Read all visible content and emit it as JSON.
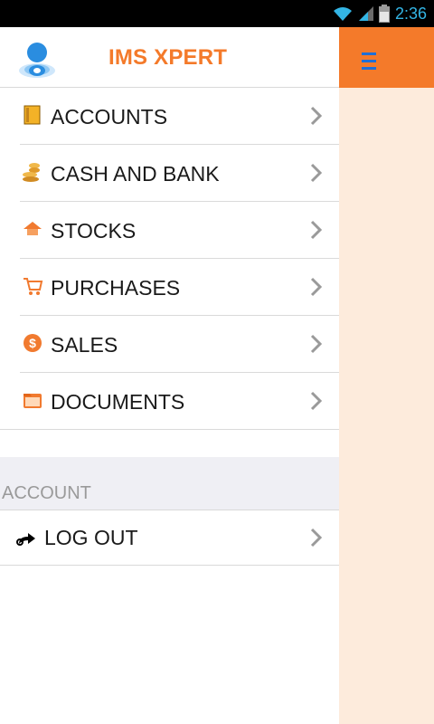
{
  "status": {
    "time": "2:36"
  },
  "app": {
    "title": "IMS XPERT"
  },
  "menu": {
    "items": [
      {
        "label": "ACCOUNTS",
        "icon": "book-icon"
      },
      {
        "label": "CASH AND BANK",
        "icon": "coins-icon"
      },
      {
        "label": "STOCKS",
        "icon": "home-icon"
      },
      {
        "label": "PURCHASES",
        "icon": "cart-icon"
      },
      {
        "label": "SALES",
        "icon": "dollar-icon"
      },
      {
        "label": "DOCUMENTS",
        "icon": "folder-icon"
      }
    ]
  },
  "account_section": {
    "label": "ACCOUNT"
  },
  "logout": {
    "label": "LOG OUT",
    "icon": "logout-icon"
  },
  "colors": {
    "accent": "#f47a2a",
    "panel": "#fdebdc",
    "section_bg": "#efeff4",
    "status_blue": "#33b5e5"
  }
}
